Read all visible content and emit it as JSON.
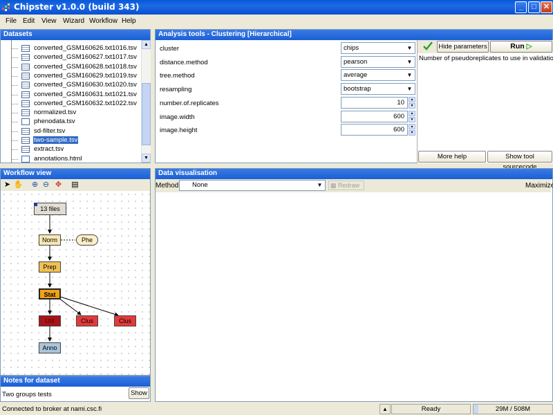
{
  "window": {
    "title": "Chipster v1.0.0 (build 343)",
    "minimize_label": "_",
    "maximize_label": "□",
    "close_label": "✕"
  },
  "menu": [
    "File",
    "Edit",
    "View",
    "Wizard",
    "Workflow",
    "Help"
  ],
  "datasets": {
    "header": "Datasets",
    "items": [
      "converted_GSM160626.txt1016.tsv",
      "converted_GSM160627.txt1017.tsv",
      "converted_GSM160628.txt1018.tsv",
      "converted_GSM160629.txt1019.tsv",
      "converted_GSM160630.txt1020.tsv",
      "converted_GSM160631.txt1021.tsv",
      "converted_GSM160632.txt1022.tsv",
      "normalized.tsv",
      "phenodata.tsv",
      "sd-filter.tsv",
      "two-sample.tsv",
      "extract.tsv",
      "annotations.html"
    ],
    "selected": "two-sample.tsv"
  },
  "analysis": {
    "header": "Analysis tools - Clustering [Hierarchical]",
    "params": [
      {
        "name": "cluster",
        "value": "chips",
        "kind": "combo"
      },
      {
        "name": "distance.method",
        "value": "pearson",
        "kind": "combo"
      },
      {
        "name": "tree.method",
        "value": "average",
        "kind": "combo"
      },
      {
        "name": "resampling",
        "value": "bootstrap",
        "kind": "combo"
      },
      {
        "name": "number.of.replicates",
        "value": "10",
        "kind": "spinner"
      },
      {
        "name": "image.width",
        "value": "600",
        "kind": "spinner"
      },
      {
        "name": "image.height",
        "value": "600",
        "kind": "spinner"
      }
    ],
    "hide_params_label": "Hide parameters",
    "run_label": "Run",
    "help_text": "Number of pseudoreplicates to use in validation",
    "more_help_label": "More help",
    "show_source_label": "Show tool sourcecode"
  },
  "workflow": {
    "header": "Workflow view",
    "nodes": {
      "files": "13 files",
      "norm": "Norm",
      "phe": "Phe",
      "prep": "Prep",
      "stat": "Stat",
      "util": "Util",
      "clus1": "Clus",
      "clus2": "Clus",
      "anno": "Anno"
    },
    "colors": {
      "files": "#e2dcd5",
      "norm": "#f7e8b3",
      "phe": "#fdf0c8",
      "prep": "#f0c153",
      "stat": "#f0a318",
      "util": "#a8141a",
      "clus": "#e23b3b",
      "anno": "#a9c5db"
    }
  },
  "notes": {
    "header": "Notes for dataset",
    "text": "Two groups tests",
    "show_label": "Show"
  },
  "visualisation": {
    "header": "Data visualisation",
    "method_label": "Method:",
    "method_value": "None",
    "redraw_label": "Redraw",
    "maximize_label": "Maximize"
  },
  "status": {
    "connection": "Connected to broker at nami.csc.fi",
    "state": "Ready",
    "memory": "29M / 508M"
  }
}
